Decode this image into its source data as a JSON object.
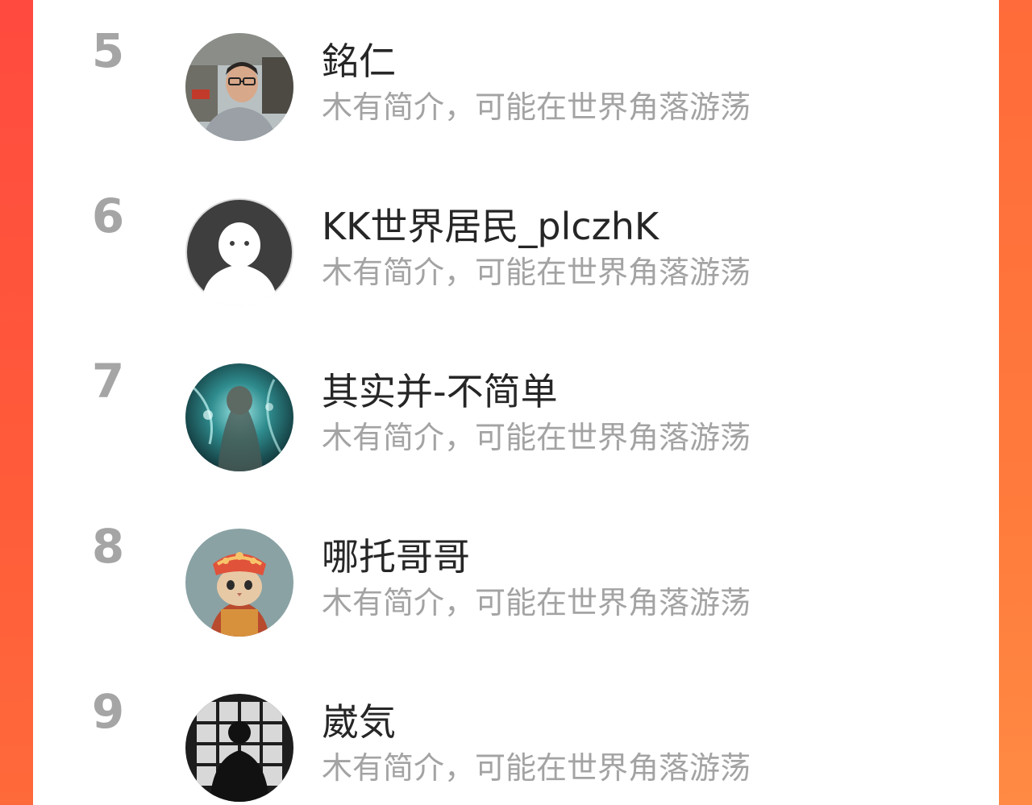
{
  "ranking": {
    "items": [
      {
        "rank": "5",
        "name": "銘仁",
        "bio": "木有简介，可能在世界角落游荡",
        "avatar_icon": "person-photo-avatar"
      },
      {
        "rank": "6",
        "name": "KK世界居民_plczhK",
        "bio": "木有简介，可能在世界角落游荡",
        "avatar_icon": "default-user-avatar"
      },
      {
        "rank": "7",
        "name": "其实并-不简单",
        "bio": "木有简介，可能在世界角落游荡",
        "avatar_icon": "teal-art-avatar"
      },
      {
        "rank": "8",
        "name": "哪托哥哥",
        "bio": "木有简介，可能在世界角落游荡",
        "avatar_icon": "cat-costume-avatar"
      },
      {
        "rank": "9",
        "name": "崴気",
        "bio": "木有简介，可能在世界角落游荡",
        "avatar_icon": "silhouette-window-avatar"
      }
    ]
  },
  "colors": {
    "background_red": "#ff4a3f",
    "background_orange": "#ff7a3c",
    "panel": "#ffffff",
    "rank_gray": "#a5a5a5",
    "name_dark": "#262626",
    "bio_gray": "#a3a3a3"
  }
}
